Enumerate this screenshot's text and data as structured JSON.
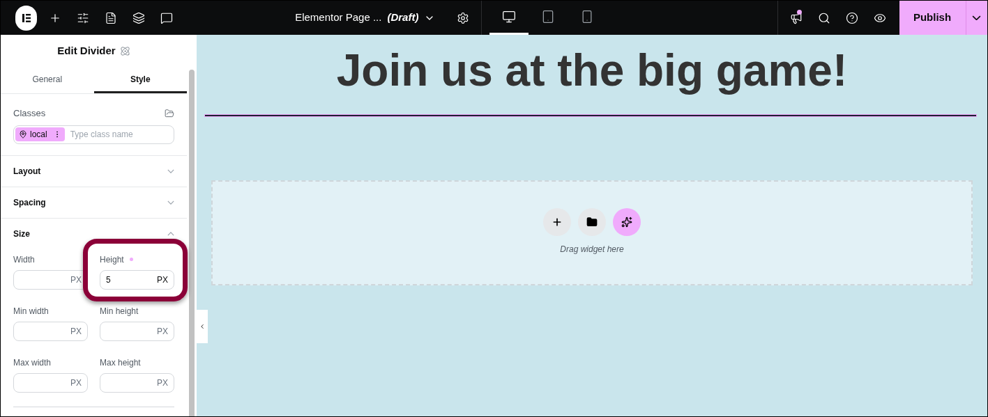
{
  "header": {
    "page_title": "Elementor Page ...",
    "status": "(Draft)",
    "devices": [
      {
        "kind": "desktop",
        "selected": true
      },
      {
        "kind": "tablet",
        "selected": false
      },
      {
        "kind": "mobile",
        "selected": false
      }
    ],
    "notification": true,
    "publish": "Publish"
  },
  "panel": {
    "title": "Edit Divider",
    "tabs": [
      {
        "label": "General",
        "selected": false
      },
      {
        "label": "Style",
        "selected": true
      }
    ],
    "classes": {
      "label": "Classes",
      "chip": "local",
      "placeholder": "Type class name"
    },
    "sections": [
      {
        "label": "Layout",
        "expanded": false
      },
      {
        "label": "Spacing",
        "expanded": false
      },
      {
        "label": "Size",
        "expanded": true
      }
    ],
    "size_fields": [
      {
        "label": "Width",
        "unit": "PX",
        "modified": false
      },
      {
        "label": "Height",
        "value": "5",
        "unit": "PX",
        "modified": true
      },
      {
        "label": "Min width",
        "unit": "PX",
        "modified": false
      },
      {
        "label": "Min height",
        "unit": "PX",
        "modified": false
      },
      {
        "label": "Max width",
        "unit": "PX",
        "modified": false
      },
      {
        "label": "Max height",
        "unit": "PX",
        "modified": false
      }
    ]
  },
  "canvas": {
    "heading": "Join us at the big game!",
    "drop_zone": "Drag widget here"
  }
}
